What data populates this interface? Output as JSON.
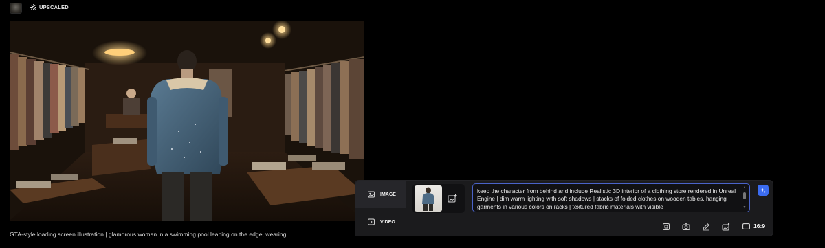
{
  "header": {
    "avatar_icon": "avatar-thumbnail",
    "badge_label": "UPSCALED",
    "badge_icon": "sparkle-icon"
  },
  "image": {
    "description_icon": "generated-image"
  },
  "caption": "GTA-style loading screen illustration | glamorous woman in a swimming pool leaning on the edge, wearing...",
  "panel": {
    "modes": [
      {
        "label": "IMAGE",
        "icon": "image-icon",
        "active": true
      },
      {
        "label": "VIDEO",
        "icon": "video-icon",
        "active": false
      }
    ],
    "reference": {
      "thumbnail_icon": "reference-image-thumbnail",
      "add_icon": "add-image-icon"
    },
    "prompt": "keep the character from behind and include Realistic 3D interior of a clothing store rendered in Unreal Engine | dim warm lighting with soft shadows | stacks of folded clothes on wooden tables, hanging garments in various colors on racks | textured fabric materials with visible",
    "enhance_icon": "magic-sparkle-icon",
    "tools": [
      "frame-icon",
      "camera-icon",
      "pen-icon",
      "image-edit-icon"
    ],
    "aspect_ratio": "16:9",
    "accent_color": "#3b6cf0"
  }
}
